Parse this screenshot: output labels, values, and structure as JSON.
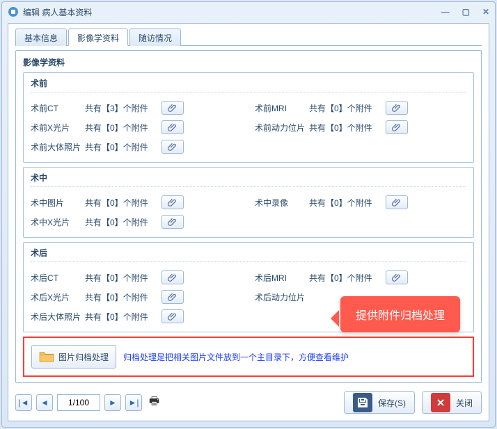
{
  "window": {
    "title": "编辑 病人基本资料"
  },
  "tabs": [
    {
      "label": "基本信息",
      "active": false
    },
    {
      "label": "影像学资料",
      "active": true
    },
    {
      "label": "随访情况",
      "active": false
    }
  ],
  "panel_title": "影像学资料",
  "sections": [
    {
      "title": "术前",
      "rows": [
        {
          "left": {
            "label": "术前CT",
            "count": "共有【3】个附件"
          },
          "right": {
            "label": "术前MRI",
            "count": "共有【0】个附件"
          }
        },
        {
          "left": {
            "label": "术前X光片",
            "count": "共有【0】个附件"
          },
          "right": {
            "label": "术前动力位片",
            "count": "共有【0】个附件"
          }
        },
        {
          "left": {
            "label": "术前大体照片",
            "count": "共有【0】个附件"
          },
          "right": null
        }
      ]
    },
    {
      "title": "术中",
      "rows": [
        {
          "left": {
            "label": "术中图片",
            "count": "共有【0】个附件"
          },
          "right": {
            "label": "术中录像",
            "count": "共有【0】个附件"
          }
        },
        {
          "left": {
            "label": "术中X光片",
            "count": "共有【0】个附件"
          },
          "right": null
        }
      ]
    },
    {
      "title": "术后",
      "rows": [
        {
          "left": {
            "label": "术后CT",
            "count": "共有【0】个附件"
          },
          "right": {
            "label": "术后MRI",
            "count": "共有【0】个附件"
          }
        },
        {
          "left": {
            "label": "术后X光片",
            "count": "共有【0】个附件"
          },
          "right": {
            "label": "术后动力位片",
            "count": ""
          }
        },
        {
          "left": {
            "label": "术后大体照片",
            "count": "共有【0】个附件"
          },
          "right": null
        }
      ]
    }
  ],
  "archive": {
    "button": "图片归档处理",
    "desc": "归档处理是把相关图片文件放到一个主目录下，方便查看维护"
  },
  "callout": "提供附件归档处理",
  "pager": {
    "value": "1/100"
  },
  "footer": {
    "save": "保存(S)",
    "close": "关闭"
  }
}
